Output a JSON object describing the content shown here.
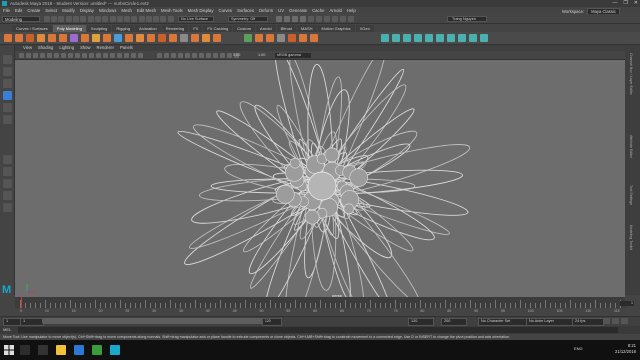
{
  "window": {
    "title": "Autodesk Maya 2018 - Student Version: untitled*  ---  nurbsCircle1.ext2",
    "controls": [
      "—",
      "❐",
      "✕"
    ]
  },
  "menubar": {
    "items": [
      "File",
      "Edit",
      "Create",
      "Select",
      "Modify",
      "Display",
      "Windows",
      "Mesh",
      "Edit Mesh",
      "Mesh Tools",
      "Mesh Display",
      "Curves",
      "Surfaces",
      "Deform",
      "UV",
      "Generate",
      "Cache",
      "Arnold",
      "Help"
    ]
  },
  "workspace": {
    "label": "Workspace:",
    "value": "Maya Classic"
  },
  "statusline": {
    "mode": "Modeling",
    "no_live": "No Live Surface",
    "symmetry": "Symmetry: Off",
    "user": "Trang Nguyen"
  },
  "shelf": {
    "tabs": [
      "Curves / Surfaces",
      "Poly Modeling",
      "Sculpting",
      "Rigging",
      "Animation",
      "Rendering",
      "FX",
      "FX Caching",
      "Custom",
      "Arnold",
      "Bifrost",
      "MASH",
      "Motion Graphics",
      "XGen"
    ],
    "active": 1
  },
  "panel": {
    "menu": [
      "View",
      "Shading",
      "Lighting",
      "Show",
      "Renderer",
      "Panels"
    ],
    "val1": "0.00",
    "val2": "1.00",
    "gamma": "sRGB gamma",
    "camera": "persp"
  },
  "rightbar": {
    "labels": [
      "Channel Box / Layer Editor",
      "Attribute Editor",
      "Tool Settings",
      "Modeling Toolkit"
    ]
  },
  "logo": "M",
  "timeslider": {
    "ticks": [
      "5",
      "10",
      "15",
      "20",
      "25",
      "30",
      "35",
      "40",
      "45",
      "50",
      "55",
      "60",
      "65",
      "70",
      "75",
      "80",
      "85",
      "90",
      "95",
      "100",
      "105",
      "110",
      "115"
    ],
    "current": "1"
  },
  "range": {
    "start": "1",
    "inner_start": "1",
    "inner_end": "120",
    "end": "120",
    "max": "200",
    "character_set": "No Character Set",
    "anim_layer": "No Anim Layer",
    "fps": "24 fps"
  },
  "mel": {
    "label": "MEL"
  },
  "help": "Move Tool: Use manipulator to move object(s). Ctrl+Shift+drag to move components along normals. Shift+drag manipulator axis or plane handle to extrude components or clone objects. Ctrl+LMB+Shift+drag to constrain movement to a connected edge. Use D or INSERT to change the pivot position and axis orientation.",
  "taskbar": {
    "lang": "ENG",
    "time": "8:21",
    "date": "21/12/2018"
  },
  "colors": {
    "accent": "#1aa9c9",
    "viewport": "#6d6d6d",
    "active_tool": "#3a7fd5"
  }
}
